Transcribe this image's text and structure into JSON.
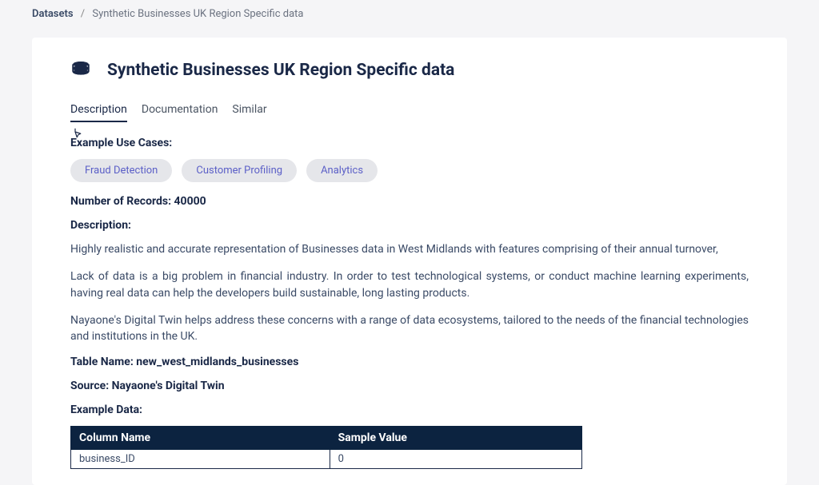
{
  "breadcrumb": {
    "root": "Datasets",
    "current": "Synthetic Businesses UK Region Specific data"
  },
  "title": "Synthetic Businesses UK Region Specific data",
  "tabs": {
    "description": "Description",
    "documentation": "Documentation",
    "similar": "Similar"
  },
  "labels": {
    "use_cases": "Example Use Cases:",
    "records_key": "Number of Records: ",
    "records_value": "40000",
    "description": "Description:",
    "table_name_key": "Table Name: ",
    "table_name_value": "new_west_midlands_businesses",
    "source_key": "Source: ",
    "source_value": "Nayaone's Digital Twin",
    "example_data": "Example Data:"
  },
  "tags": [
    "Fraud Detection",
    "Customer Profiling",
    "Analytics"
  ],
  "description_paragraphs": [
    "Highly realistic and accurate representation of Businesses data in West Midlands with features comprising of their annual turnover,",
    "Lack of data is a big problem in financial industry. In order to test technological systems, or conduct machine learning experiments, having real data can help the developers build sustainable, long lasting products.",
    "Nayaone's Digital Twin helps address these concerns with a range of data ecosystems, tailored to the needs of the financial technologies and institutions in the UK."
  ],
  "table": {
    "headers": [
      "Column Name",
      "Sample Value"
    ],
    "rows": [
      [
        "business_ID",
        "0"
      ]
    ]
  }
}
